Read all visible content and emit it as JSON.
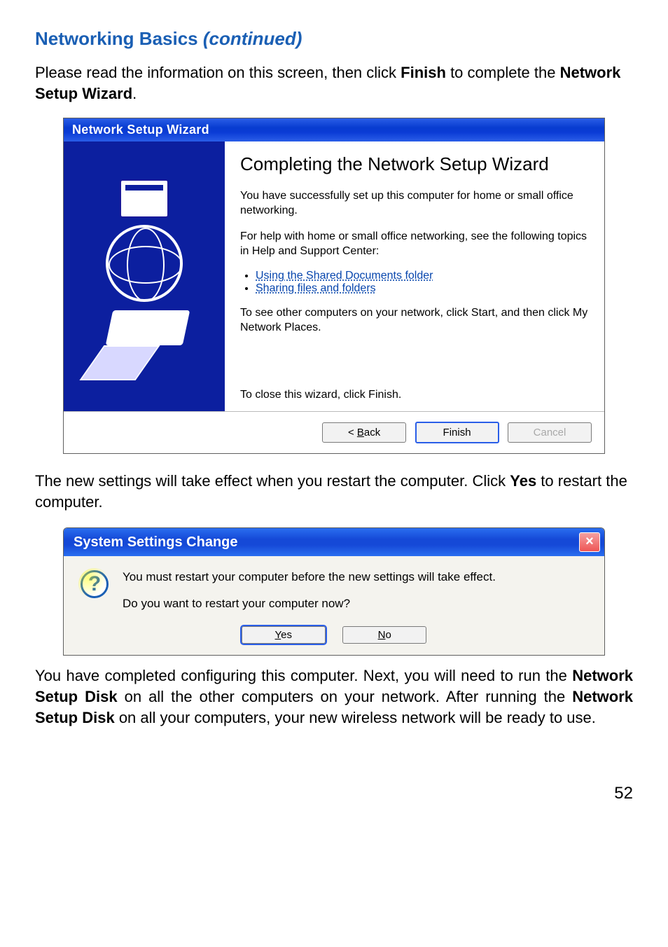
{
  "page": {
    "title_main": "Networking Basics ",
    "title_continued": "(continued)",
    "intro_pre": "Please read the information on this screen, then click ",
    "intro_bold": "Finish",
    "intro_mid": " to complete the ",
    "intro_bold2": "Network Setup Wizard",
    "intro_post": ".",
    "mid_pre": "The new settings will take effect when you restart the computer. Click ",
    "mid_bold": "Yes",
    "mid_post": " to restart the computer.",
    "outro_pre": "You have completed configuring this computer. Next, you will need to run the ",
    "outro_b1": "Network Setup Disk",
    "outro_mid1": " on all the other computers on your network. After running the ",
    "outro_b2": "Network Setup Disk",
    "outro_mid2": " on all your computers, your new wireless network will be ready to use.",
    "number": "52"
  },
  "wizard": {
    "title": "Network Setup Wizard",
    "heading": "Completing the Network Setup Wizard",
    "p1": "You have successfully set up this computer for home or small office networking.",
    "p2": "For help with home or small office networking, see the following topics in Help and Support Center:",
    "link1": "Using the Shared Documents folder",
    "link2": "Sharing files and folders",
    "p3": "To see other computers on your network, click Start, and then click My Network Places.",
    "close_text": "To close this wizard, click Finish.",
    "btn_back": "< Back",
    "btn_back_u": "B",
    "btn_back_pre": "< ",
    "btn_back_post": "ack",
    "btn_finish": "Finish",
    "btn_cancel": "Cancel"
  },
  "msgbox": {
    "title": "System Settings Change",
    "line1": "You must restart your computer before the new settings will take effect.",
    "line2": "Do you want to restart your computer now?",
    "btn_yes_u": "Y",
    "btn_yes_post": "es",
    "btn_no_u": "N",
    "btn_no_post": "o"
  }
}
